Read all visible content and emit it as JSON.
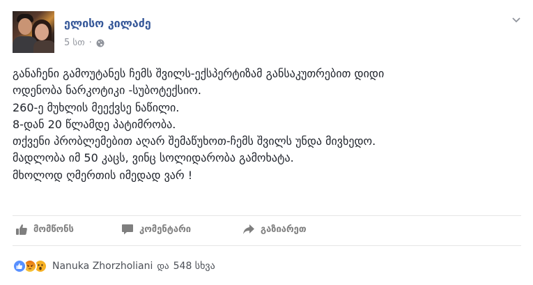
{
  "post": {
    "author_name": "ელისო კილაძე",
    "timestamp": "5 სთ",
    "separator": "·",
    "privacy_icon": "globe-icon",
    "options_icon": "chevron-down-icon",
    "lines": [
      "განაჩენი გამოუტანეს ჩემს შვილს-ექსპერტიზამ განსაკუთრებით დიდი",
      "ოდენობა ნარკოტიკი -სუბოტექსიო.",
      "260-ე მუხლის მეექვსე ნაწილი.",
      "8-დან 20 წლამდე პატიმრობა.",
      "თქვენი პრობლემებით აღარ შემაწუხოთ-ჩემს შვილს უნდა მივხედო.",
      "მადლობა იმ 50 კაცს, ვინც სოლიდარობა გამოხატა.",
      "მხოლოდ ღმერთის იმედად ვარ !"
    ]
  },
  "actions": {
    "like_label": "მომწონს",
    "comment_label": "კომენტარი",
    "share_label": "გაზიარეთ"
  },
  "reactions": {
    "types": [
      "like",
      "angry",
      "wow"
    ],
    "colors": {
      "like": "#5890ff",
      "angry": "#e9710f",
      "wow": "#f7b125"
    },
    "first_name": "Nanuka Zhorzholiani",
    "and_word": "და",
    "others_text": "548 სხვა"
  }
}
